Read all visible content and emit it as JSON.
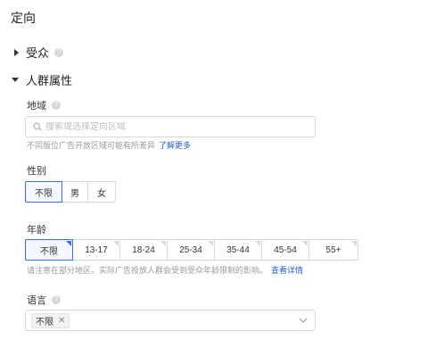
{
  "page": {
    "title": "定向"
  },
  "sections": {
    "audience": {
      "label": "受众",
      "help": "?"
    },
    "attributes": {
      "label": "人群属性"
    }
  },
  "region": {
    "label": "地域",
    "help": "?",
    "placeholder": "搜索或选择定向区域",
    "hint": "不同版位广告开放区域可能有所差异",
    "link": "了解更多"
  },
  "gender": {
    "label": "性别",
    "options": [
      "不限",
      "男",
      "女"
    ],
    "selected": "不限"
  },
  "age": {
    "label": "年龄",
    "options": [
      "不限",
      "13-17",
      "18-24",
      "25-34",
      "35-44",
      "45-54",
      "55+"
    ],
    "selected": "不限",
    "hint": "请注意在部分地区，实际广告投放人群会受到受众年龄限制的影响。",
    "link": "查看详情"
  },
  "language": {
    "label": "语言",
    "help": "?",
    "selected_tag": "不限",
    "remove_glyph": "✕"
  },
  "colors": {
    "accent": "#3a6fd8",
    "link": "#2a62c9"
  },
  "icons": {
    "search": "search-icon",
    "chevron": "chevron-down-icon",
    "expand": "caret-right-icon",
    "collapse": "caret-down-icon"
  }
}
